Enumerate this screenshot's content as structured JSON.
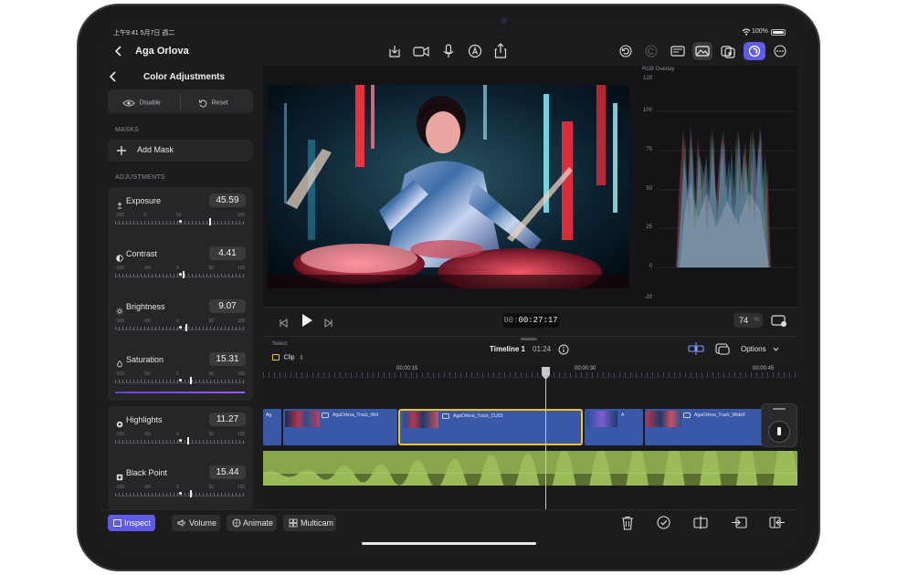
{
  "status_bar": {
    "time": "上午9:41",
    "date": "5月7日 週二",
    "battery": "100%"
  },
  "header": {
    "project_title": "Aga Orlova"
  },
  "left_panel": {
    "title": "Color Adjustments",
    "disable_label": "Disable",
    "reset_label": "Reset",
    "masks_label": "MASKS",
    "add_mask_label": "Add Mask",
    "adjustments_label": "ADJUSTMENTS",
    "adjustments": [
      {
        "label": "Exposure",
        "value": "45.59",
        "icon": "plus-minus-icon",
        "scale": [
          "-100",
          "0",
          "50",
          "100"
        ],
        "level": 45.59
      },
      {
        "label": "Contrast",
        "value": "4.41",
        "icon": "contrast-icon",
        "scale": [
          "-100",
          "-50",
          "0",
          "50",
          "100"
        ],
        "level": 4.41
      },
      {
        "label": "Brightness",
        "value": "9.07",
        "icon": "sun-icon",
        "scale": [
          "-100",
          "-50",
          "0",
          "50",
          "100"
        ],
        "level": 9.07
      },
      {
        "label": "Saturation",
        "value": "15.31",
        "icon": "drop-icon",
        "scale": [
          "-100",
          "-50",
          "0",
          "50",
          "100"
        ],
        "level": 15.31
      },
      {
        "label": "Highlights",
        "value": "11.27",
        "icon": "highlights-icon",
        "scale": [
          "-100",
          "-50",
          "0",
          "50",
          "100"
        ],
        "level": 11.27
      },
      {
        "label": "Black Point",
        "value": "15.44",
        "icon": "black-point-icon",
        "scale": [
          "-100",
          "-50",
          "0",
          "50",
          "100"
        ],
        "level": 15.44
      }
    ]
  },
  "viewer": {
    "timecode_prefix": "00:",
    "timecode_main": "00:27:17",
    "zoom_value": "74",
    "zoom_unit": "%"
  },
  "scope": {
    "title": "RGB Overlay",
    "scale": [
      "120",
      "100",
      "75",
      "50",
      "25",
      "0",
      "-20"
    ]
  },
  "timeline": {
    "select_label": "Select",
    "clip_label": "Clip",
    "name": "Timeline 1",
    "duration": "01:24",
    "options_label": "Options",
    "ruler_marks": [
      "00:00:15",
      "00:00:30",
      "00:00:45"
    ],
    "clips": [
      "Ag",
      "AgaOrlova_Track_Wid",
      "AgaOrlova_Track_CU03",
      "A",
      "AgaOrlova_Track_Wide0"
    ]
  },
  "bottom_bar": {
    "inspect_label": "Inspect",
    "volume_label": "Volume",
    "animate_label": "Animate",
    "multicam_label": "Multicam"
  },
  "colors": {
    "accent": "#5e5ce6",
    "clip_blue": "#3a58a8",
    "audio_green": "#8aa64c",
    "selection_yellow": "#f5c518"
  }
}
